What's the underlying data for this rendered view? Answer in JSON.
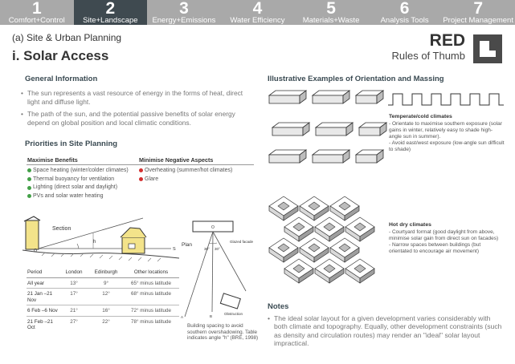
{
  "tabs": [
    {
      "num": "1",
      "label": "Comfort+Control",
      "active": false
    },
    {
      "num": "2",
      "label": "Site+Landscape",
      "active": true
    },
    {
      "num": "3",
      "label": "Energy+Emissions",
      "active": false
    },
    {
      "num": "4",
      "label": "Water Efficiency",
      "active": false
    },
    {
      "num": "5",
      "label": "Materials+Waste",
      "active": false
    },
    {
      "num": "6",
      "label": "Analysis Tools",
      "active": false
    },
    {
      "num": "7",
      "label": "Project Management",
      "active": false
    }
  ],
  "header": {
    "subtitle": "(a) Site & Urban Planning",
    "title": "i. Solar Access",
    "brand": "RED",
    "brand_sub": "Rules of Thumb"
  },
  "general": {
    "heading": "General Information",
    "bullets": [
      "The sun represents a vast resource of energy in the forms of heat, direct light and diffuse light.",
      "The path of the sun, and the potential passive benefits of solar energy depend on global position and local climatic conditions."
    ]
  },
  "priorities": {
    "heading": "Priorities in Site Planning",
    "col_max": "Maximise Benefits",
    "col_min": "Minimise Negative Aspects",
    "maximise": [
      "Space heating (winter/colder climates)",
      "Thermal buoyancy for ventilation",
      "Lighting (direct solar and daylight)",
      "PVs and solar water heating"
    ],
    "minimise": [
      "Overheating (summer/hot climates)",
      "Glare"
    ]
  },
  "section_diagram": {
    "label": "Section",
    "angle_label": "h",
    "point_label": "O",
    "s_label": "S"
  },
  "plan_diagram": {
    "label": "Plan",
    "o_label": "O",
    "glazed": "Glazed facade",
    "a_label": "A",
    "b_label": "B",
    "angle_left": "30°",
    "angle_right": "30°",
    "obstruction": "Obstruction"
  },
  "sun_table": {
    "headers": [
      "Period",
      "London",
      "Edinburgh",
      "Other locations"
    ],
    "rows": [
      [
        "All year",
        "13°",
        "9°",
        "65° minus latitude"
      ],
      [
        "21 Jan –21 Nov",
        "17°",
        "12°",
        "68° minus latitude"
      ],
      [
        "6 Feb –6 Nov",
        "21°",
        "16°",
        "72° minus latitude"
      ],
      [
        "21 Feb –21 Oct",
        "27°",
        "22°",
        "78° minus latitude"
      ]
    ]
  },
  "spacing_caption": "Building spacing to avoid southern overshadowing. Table indicates angle \"h\" (BRE, 1998)",
  "examples": {
    "heading": "Illustrative Examples of Orientation and Massing",
    "temperate_head": "Temperate/cold climates",
    "temperate_text": "- Orientate to maximise southern exposure (solar gains in winter, relatively easy to shade high-angle sun in summer).\n- Avoid east/west exposure (low-angle sun difficult to shade)",
    "hot_head": "Hot dry climates",
    "hot_text": "- Courtyard format (good daylight from above, minimise solar gain from direct sun on facades)\n- Narrow spaces between buildings (but orientated to encourage air movement)"
  },
  "notes": {
    "heading": "Notes",
    "text": "The ideal solar layout for a given development varies considerably with both climate and topography. Equally, other development constraints (such as density and circulation routes) may render an \"ideal\" solar layout impractical."
  },
  "colors": {
    "tab_bg": "#a9a9a9",
    "tab_active": "#3f4a50",
    "heading": "#3a4a52",
    "green_dot": "#43a047",
    "red_dot": "#d32f2f"
  }
}
